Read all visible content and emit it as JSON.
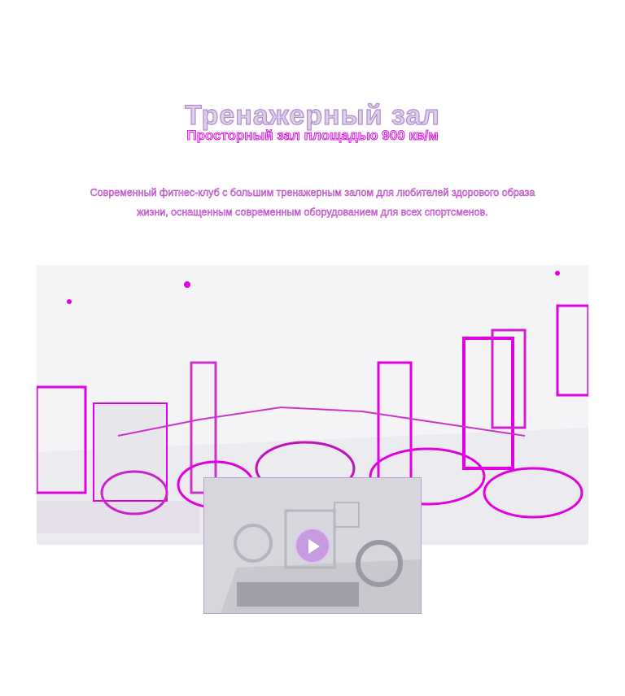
{
  "section": {
    "title": "Тренажерный зал",
    "subtitle": "Просторный зал площадью 900 кв/м",
    "description": "Современный фитнес-клуб с большим тренажерным залом для любителей здорового образа жизни, оснащенным современным оборудованием для всех спортсменов."
  },
  "media": {
    "photo_icon": "gym-photo",
    "video_icon": "play-icon"
  },
  "colors": {
    "accent": "#d000d8",
    "title_fill": "#d9d2e6",
    "photo_background": "#f4f4f7"
  }
}
